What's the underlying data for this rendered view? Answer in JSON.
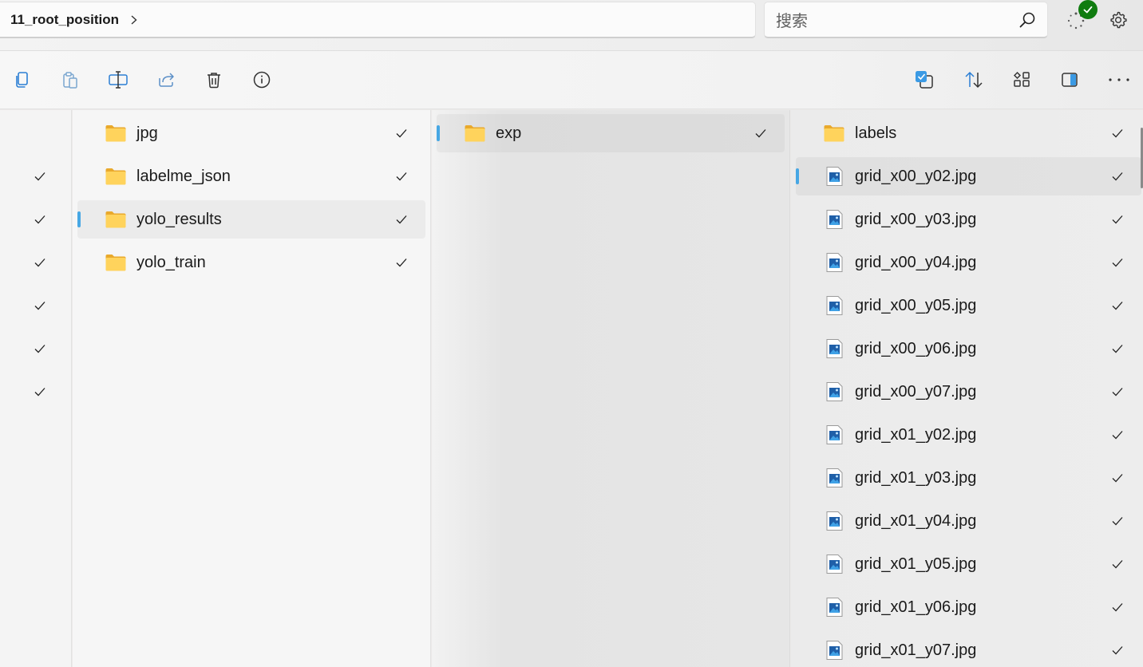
{
  "address": {
    "crumb": "11_root_position"
  },
  "search": {
    "placeholder": "搜索"
  },
  "toolbar": {
    "left": [
      "copy-icon",
      "paste-icon",
      "rename-icon",
      "share-icon",
      "delete-icon",
      "info-icon"
    ],
    "right": [
      "select-icon",
      "sort-icon",
      "view-icon",
      "preview-pane-icon",
      "more-icon"
    ]
  },
  "column1": {
    "items": [
      {
        "label": "jpg",
        "type": "folder",
        "selected": false
      },
      {
        "label": "labelme_json",
        "type": "folder",
        "selected": false
      },
      {
        "label": "yolo_results",
        "type": "folder",
        "selected": true
      },
      {
        "label": "yolo_train",
        "type": "folder",
        "selected": false
      }
    ]
  },
  "column2": {
    "items": [
      {
        "label": "exp",
        "type": "folder",
        "selected": true
      }
    ]
  },
  "column3": {
    "items": [
      {
        "label": "labels",
        "type": "folder",
        "selected": false
      },
      {
        "label": "grid_x00_y02.jpg",
        "type": "image",
        "selected": true
      },
      {
        "label": "grid_x00_y03.jpg",
        "type": "image",
        "selected": false
      },
      {
        "label": "grid_x00_y04.jpg",
        "type": "image",
        "selected": false
      },
      {
        "label": "grid_x00_y05.jpg",
        "type": "image",
        "selected": false
      },
      {
        "label": "grid_x00_y06.jpg",
        "type": "image",
        "selected": false
      },
      {
        "label": "grid_x00_y07.jpg",
        "type": "image",
        "selected": false
      },
      {
        "label": "grid_x01_y02.jpg",
        "type": "image",
        "selected": false
      },
      {
        "label": "grid_x01_y03.jpg",
        "type": "image",
        "selected": false
      },
      {
        "label": "grid_x01_y04.jpg",
        "type": "image",
        "selected": false
      },
      {
        "label": "grid_x01_y05.jpg",
        "type": "image",
        "selected": false
      },
      {
        "label": "grid_x01_y06.jpg",
        "type": "image",
        "selected": false
      },
      {
        "label": "grid_x01_y07.jpg",
        "type": "image",
        "selected": false
      }
    ]
  },
  "colors": {
    "accent": "#47a7e4",
    "sync_ok": "#107c10",
    "folder": "#f8c94a"
  }
}
